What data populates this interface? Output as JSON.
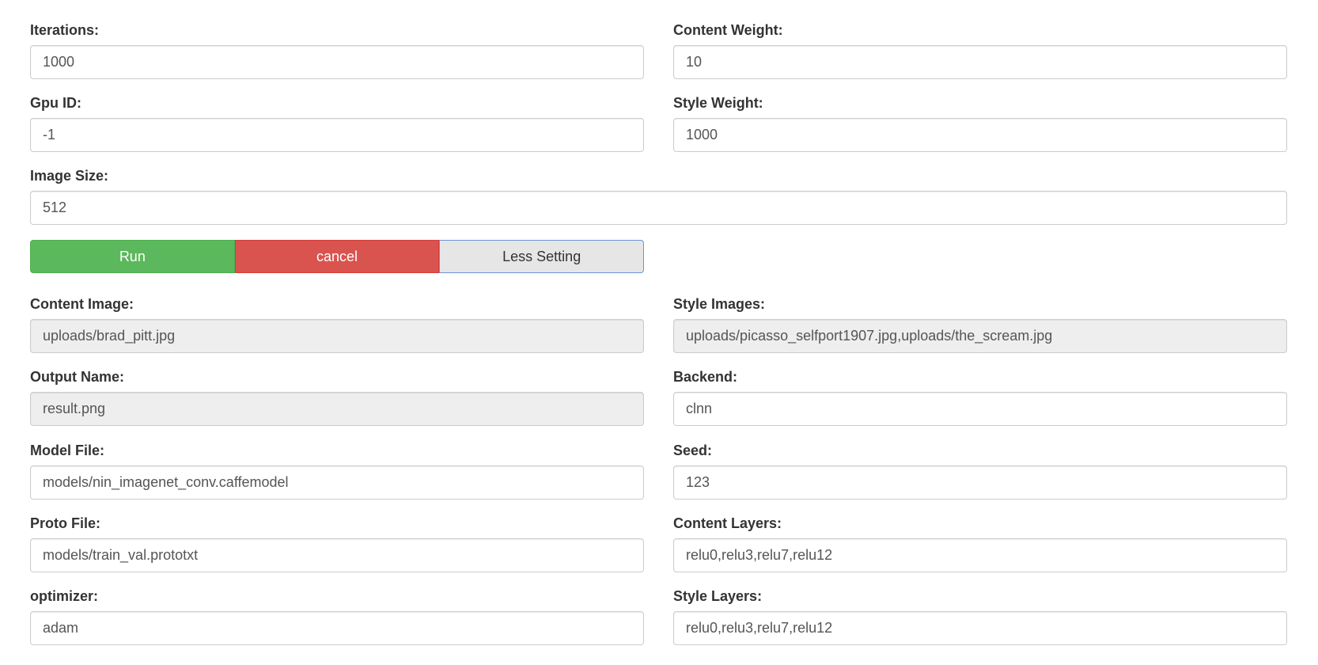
{
  "fields": {
    "iterations": {
      "label": "Iterations:",
      "value": "1000"
    },
    "content_weight": {
      "label": "Content Weight:",
      "value": "10"
    },
    "gpu_id": {
      "label": "Gpu ID:",
      "value": "-1"
    },
    "style_weight": {
      "label": "Style Weight:",
      "value": "1000"
    },
    "image_size": {
      "label": "Image Size:",
      "value": "512"
    },
    "content_image": {
      "label": "Content Image:",
      "value": "uploads/brad_pitt.jpg"
    },
    "style_images": {
      "label": "Style Images:",
      "value": "uploads/picasso_selfport1907.jpg,uploads/the_scream.jpg"
    },
    "output_name": {
      "label": "Output Name:",
      "value": "result.png"
    },
    "backend": {
      "label": "Backend:",
      "value": "clnn"
    },
    "model_file": {
      "label": "Model File:",
      "value": "models/nin_imagenet_conv.caffemodel"
    },
    "seed": {
      "label": "Seed:",
      "value": "123"
    },
    "proto_file": {
      "label": "Proto File:",
      "value": "models/train_val.prototxt"
    },
    "content_layers": {
      "label": "Content Layers:",
      "value": "relu0,relu3,relu7,relu12"
    },
    "optimizer": {
      "label": "optimizer:",
      "value": "adam"
    },
    "style_layers": {
      "label": "Style Layers:",
      "value": "relu0,relu3,relu7,relu12"
    }
  },
  "buttons": {
    "run": "Run",
    "cancel": "cancel",
    "less_setting": "Less Setting"
  },
  "colors": {
    "run": "#5cb85c",
    "cancel": "#d9534f",
    "less_setting": "#e6e6e6",
    "readonly_field": "#eeeeee"
  }
}
